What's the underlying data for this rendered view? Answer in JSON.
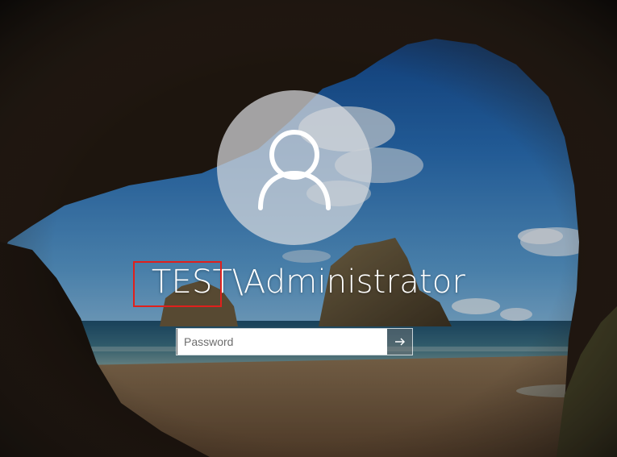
{
  "lock_screen": {
    "username": "TEST\\Administrator",
    "password_placeholder": "Password",
    "submit_icon": "arrow-right-icon",
    "avatar_icon": "user-icon",
    "highlight_color": "#e0201c"
  }
}
